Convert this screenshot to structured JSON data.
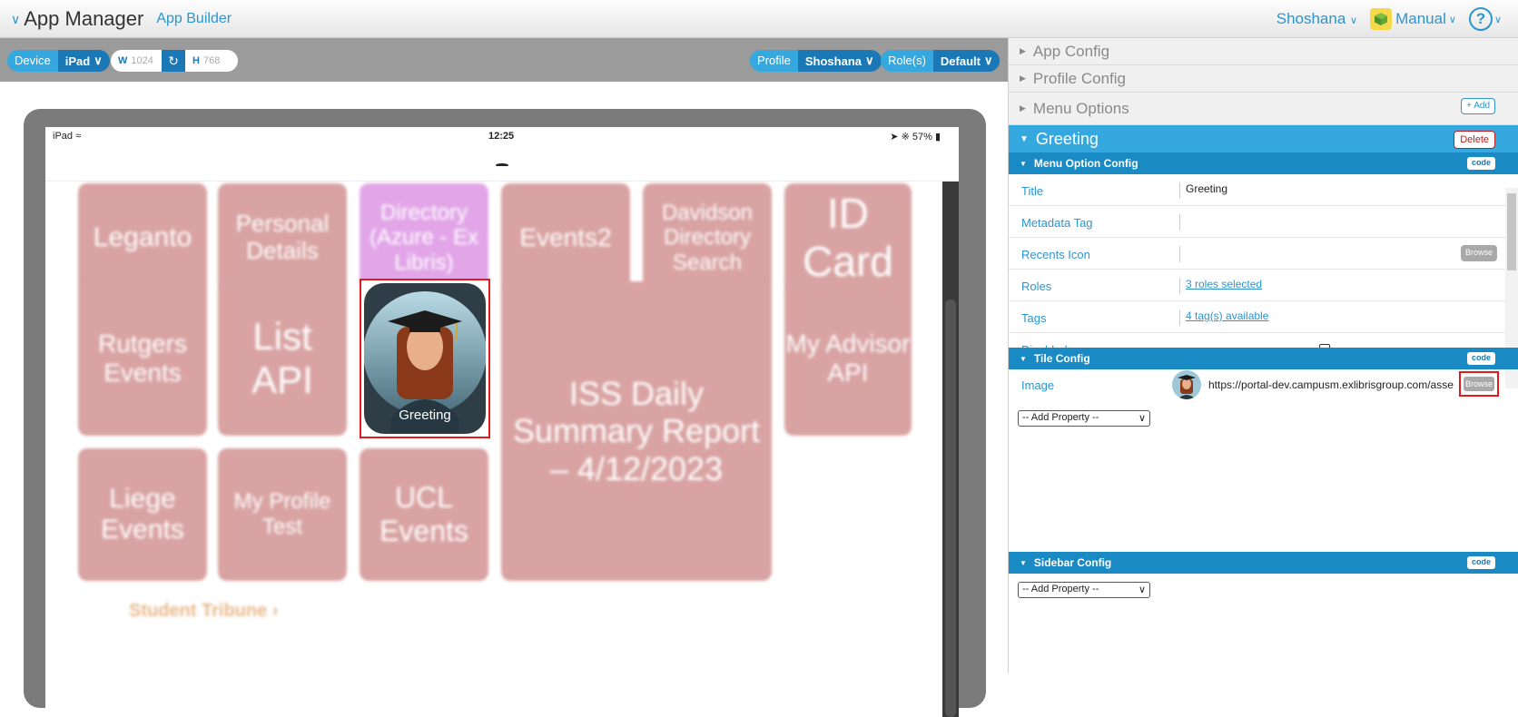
{
  "header": {
    "app_title": "App Manager",
    "sub_title": "App Builder",
    "user": "Shoshana",
    "manual": "Manual",
    "help": "?"
  },
  "controls": {
    "device_label": "Device",
    "device_value": "iPad",
    "width_label": "W",
    "width_value": "1024",
    "height_label": "H",
    "height_value": "768",
    "profile_label": "Profile",
    "profile_value": "Shoshana",
    "roles_label": "Role(s)",
    "roles_value": "Default"
  },
  "device_screen": {
    "carrier": "iPad",
    "time": "12:25",
    "battery": "57%",
    "tiles": [
      "Leganto",
      "Personal Details",
      "Directory (Azure - Ex Libris)",
      "Events2",
      "Davidson Directory Search",
      "ID Card",
      "Rutgers Events",
      "List API",
      "ISS Daily Summary Report – 4/12/2023",
      "My Advisor API",
      "Liege Events",
      "My Profile Test",
      "UCL Events"
    ],
    "greeting_tile": "Greeting",
    "bottom_link": "Student Tribune"
  },
  "panel": {
    "app_config": "App Config",
    "profile_config": "Profile Config",
    "menu_options": "Menu Options",
    "add_label": "+ Add",
    "greeting_title": "Greeting",
    "delete_label": "Delete",
    "menu_option_config": "Menu Option Config",
    "code_label": "code",
    "fields": {
      "title_label": "Title",
      "title_value": "Greeting",
      "metadata_label": "Metadata Tag",
      "recents_label": "Recents Icon",
      "browse_label": "Browse",
      "roles_label": "Roles",
      "roles_value": "3 roles selected",
      "tags_label": "Tags",
      "tags_value": "4 tag(s) available",
      "disabled_label": "Disabled"
    },
    "tile_config": "Tile Config",
    "image_label": "Image",
    "image_url": "https://portal-dev.campusm.exlibrisgroup.com/asset",
    "add_property": "-- Add Property --",
    "sidebar_config": "Sidebar Config"
  }
}
